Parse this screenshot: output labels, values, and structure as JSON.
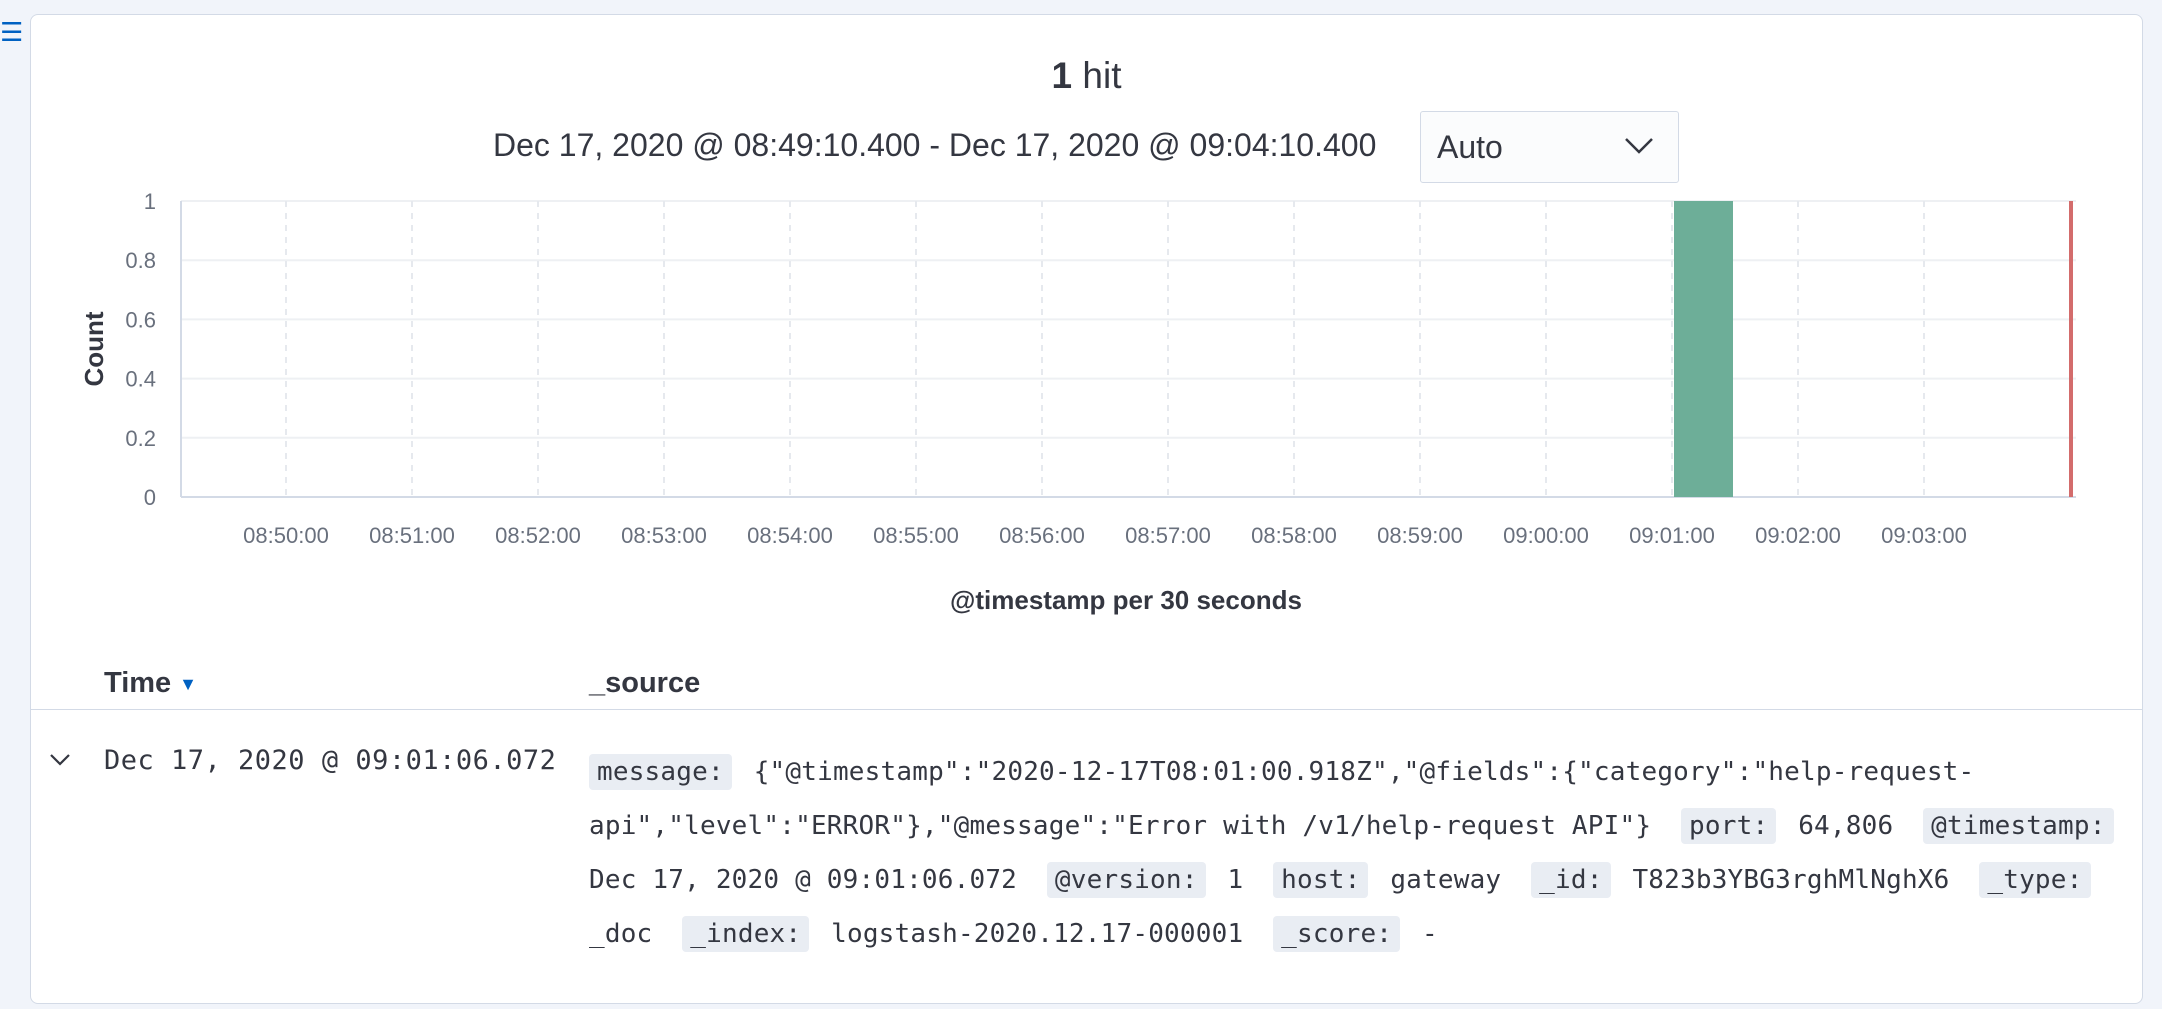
{
  "hits": {
    "count": "1",
    "label": "hit"
  },
  "time_range": "Dec 17, 2020 @ 08:49:10.400 - Dec 17, 2020 @ 09:04:10.400",
  "interval_select": {
    "value": "Auto"
  },
  "colors": {
    "bar": "#6dae98",
    "now_marker": "#d36c6c",
    "accent": "#0061c2"
  },
  "chart_data": {
    "type": "bar",
    "ylabel": "Count",
    "xlabel": "@timestamp per 30 seconds",
    "ylim": [
      0,
      1
    ],
    "yticks": [
      "0",
      "0.2",
      "0.4",
      "0.6",
      "0.8",
      "1"
    ],
    "xticks": [
      "08:50:00",
      "08:51:00",
      "08:52:00",
      "08:53:00",
      "08:54:00",
      "08:55:00",
      "08:56:00",
      "08:57:00",
      "08:58:00",
      "08:59:00",
      "09:00:00",
      "09:01:00",
      "09:02:00",
      "09:03:00"
    ],
    "bars": [
      {
        "x": "09:01:00",
        "value": 1
      }
    ],
    "now_marker": "09:04:10",
    "grid": true
  },
  "table": {
    "columns": {
      "time": "Time",
      "source": "_source"
    },
    "rows": [
      {
        "time": "Dec 17, 2020 @ 09:01:06.072",
        "fields": [
          {
            "key": "message:",
            "value": "{\"@timestamp\":\"2020-12-17T08:01:00.918Z\",\"@fields\":{\"category\":\"help-request-api\",\"level\":\"ERROR\"},\"@message\":\"Error with /v1/help-request API\"}"
          },
          {
            "key": "port:",
            "value": "64,806"
          },
          {
            "key": "@timestamp:",
            "value": "Dec 17, 2020 @ 09:01:06.072"
          },
          {
            "key": "@version:",
            "value": "1"
          },
          {
            "key": "host:",
            "value": "gateway"
          },
          {
            "key": "_id:",
            "value": "T823b3YBG3rghMlNghX6"
          },
          {
            "key": "_type:",
            "value": "_doc"
          },
          {
            "key": "_index:",
            "value": "logstash-2020.12.17-000001"
          },
          {
            "key": "_score:",
            "value": "-"
          }
        ]
      }
    ]
  }
}
